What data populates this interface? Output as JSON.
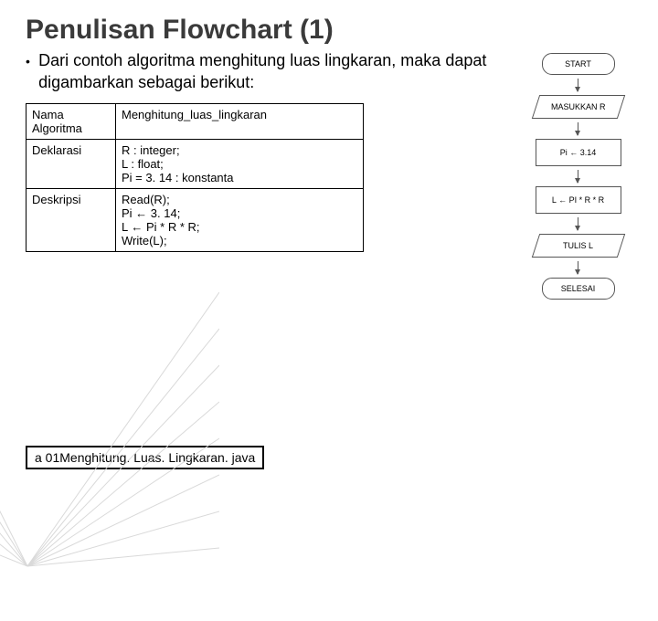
{
  "title": "Penulisan Flowchart (1)",
  "bullet_text": "Dari contoh algoritma menghitung luas lingkaran, maka dapat digambarkan sebagai berikut:",
  "table": {
    "rows": [
      {
        "label": "Nama Algoritma",
        "value": "Menghitung_luas_lingkaran"
      },
      {
        "label": "Deklarasi",
        "value": "R : integer;\nL : float;\nPi = 3. 14 : konstanta"
      },
      {
        "label": "Deskripsi",
        "value": "Read(R);\nPi ← 3. 14;\nL ← Pi * R * R;\nWrite(L);"
      }
    ]
  },
  "flowchart": {
    "start": "START",
    "input": "MASUKKAN R",
    "step1": "Pi ← 3.14",
    "step2": "L ← PI * R * R",
    "output": "TULIS L",
    "end": "SELESAI"
  },
  "footer": "a 01Menghitung. Luas. Lingkaran. java"
}
